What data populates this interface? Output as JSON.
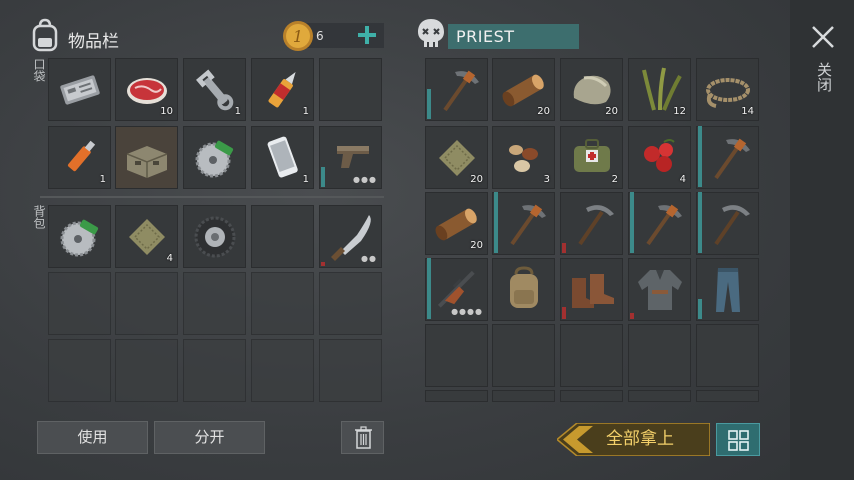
{
  "inventory": {
    "title": "物品栏",
    "coins": "6",
    "pocket_label": "口袋",
    "backpack_label": "背包",
    "pocket_slots": [
      {
        "item": "electronic-board",
        "qty": ""
      },
      {
        "item": "raw-meat",
        "qty": "10"
      },
      {
        "item": "wrench",
        "qty": "1"
      },
      {
        "item": "glue",
        "qty": "1"
      },
      {
        "item": "",
        "qty": ""
      },
      {
        "item": "usb-stick",
        "qty": "1"
      },
      {
        "item": "wooden-crate",
        "qty": ""
      },
      {
        "item": "saw-blade",
        "qty": ""
      },
      {
        "item": "smartphone",
        "qty": "1"
      },
      {
        "item": "pistol",
        "qty": ""
      }
    ],
    "backpack_slots": [
      {
        "item": "saw-blade",
        "qty": ""
      },
      {
        "item": "cloth",
        "qty": "4"
      },
      {
        "item": "tire",
        "qty": ""
      },
      {
        "item": "",
        "qty": ""
      },
      {
        "item": "machete",
        "qty": ""
      }
    ]
  },
  "loot": {
    "owner_name": "PRIEST",
    "slots": [
      {
        "item": "pickaxe",
        "qty": ""
      },
      {
        "item": "log",
        "qty": "20"
      },
      {
        "item": "stone",
        "qty": "20"
      },
      {
        "item": "plant-fiber",
        "qty": "12"
      },
      {
        "item": "rope",
        "qty": "14"
      },
      {
        "item": "cloth",
        "qty": "20"
      },
      {
        "item": "nuts",
        "qty": "3"
      },
      {
        "item": "first-aid-bag",
        "qty": "2"
      },
      {
        "item": "berries",
        "qty": "4"
      },
      {
        "item": "pickaxe",
        "qty": ""
      },
      {
        "item": "log",
        "qty": "20"
      },
      {
        "item": "pickaxe",
        "qty": ""
      },
      {
        "item": "pickaxe-iron",
        "qty": ""
      },
      {
        "item": "pickaxe",
        "qty": ""
      },
      {
        "item": "pickaxe-iron",
        "qty": ""
      },
      {
        "item": "rifle",
        "qty": ""
      },
      {
        "item": "backpack",
        "qty": ""
      },
      {
        "item": "boots",
        "qty": ""
      },
      {
        "item": "jacket",
        "qty": ""
      },
      {
        "item": "pants",
        "qty": ""
      }
    ]
  },
  "buttons": {
    "use": "使用",
    "split": "分开",
    "take_all": "全部拿上",
    "close": "关闭"
  },
  "colors": {
    "accent_teal": "#3d6e6e",
    "take_all_gold": "#f3d06a",
    "durability": "#3c8a8a",
    "durability_low": "#a23030"
  }
}
